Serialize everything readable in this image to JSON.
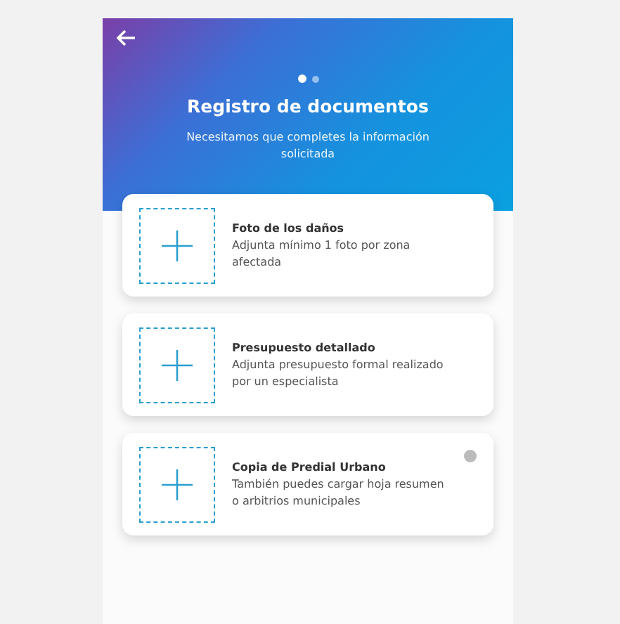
{
  "header": {
    "title": "Registro de documentos",
    "subtitle": "Necesitamos que completes la información solicitada",
    "steps": [
      {
        "selected": true
      },
      {
        "selected": false
      }
    ]
  },
  "documents": [
    {
      "title": "Foto de los daños",
      "description": "Adjunta mínimo 1 foto por zona afectada",
      "info": false
    },
    {
      "title": "Presupuesto detallado",
      "description": "Adjunta presupuesto formal realizado por un especialista",
      "info": false
    },
    {
      "title": "Copia de Predial Urbano",
      "description": "También puedes cargar hoja resumen o arbitrios municipales",
      "info": true
    }
  ]
}
